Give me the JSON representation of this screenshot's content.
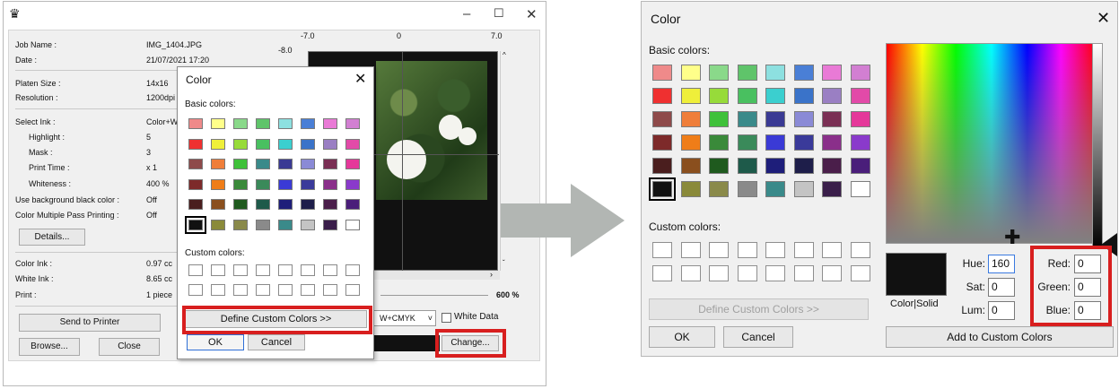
{
  "app": {
    "info": [
      {
        "label": "Job Name :",
        "value": "IMG_1404.JPG"
      },
      {
        "label": "Date :",
        "value": "21/07/2021 17:20"
      },
      {
        "label": "Platen Size :",
        "value": "14x16"
      },
      {
        "label": "Resolution :",
        "value": "1200dpi x"
      },
      {
        "label": "Select Ink :",
        "value": "Color+W"
      },
      {
        "label": "Highlight :",
        "value": "5"
      },
      {
        "label": "Mask :",
        "value": "3"
      },
      {
        "label": "Print Time :",
        "value": "x 1"
      },
      {
        "label": "Whiteness :",
        "value": "400 %"
      },
      {
        "label": "Use background black color :",
        "value": "Off"
      },
      {
        "label": "Color Multiple Pass Printing :",
        "value": "Off"
      },
      {
        "label": "Color Ink :",
        "value": "0.97 cc"
      },
      {
        "label": "White Ink :",
        "value": "8.65 cc"
      },
      {
        "label": "Print :",
        "value": "1 piece"
      }
    ],
    "details_label": "Details...",
    "send_label": "Send to Printer",
    "browse_label": "Browse...",
    "close_label": "Close",
    "ruler": {
      "top_left": "-7.0",
      "top_mid": "0",
      "top_right": "7.0",
      "side_top": "-8.0"
    },
    "zoom": "600 %",
    "ink_mode": "W+CMYK",
    "white_data_label": "White Data",
    "change_label": "Change..."
  },
  "small_dialog": {
    "title": "Color",
    "basic_label": "Basic colors:",
    "custom_label": "Custom colors:",
    "define_label": "Define Custom Colors >>",
    "ok_label": "OK",
    "cancel_label": "Cancel"
  },
  "big_dialog": {
    "title": "Color",
    "basic_label": "Basic colors:",
    "custom_label": "Custom colors:",
    "define_label": "Define Custom Colors >>",
    "ok_label": "OK",
    "cancel_label": "Cancel",
    "color_solid_label": "Color|Solid",
    "hue_label": "Hue:",
    "hue_value": "160",
    "sat_label": "Sat:",
    "sat_value": "0",
    "lum_label": "Lum:",
    "lum_value": "0",
    "red_label": "Red:",
    "red_value": "0",
    "green_label": "Green:",
    "green_value": "0",
    "blue_label": "Blue:",
    "blue_value": "0",
    "add_label": "Add to Custom Colors"
  },
  "palette": [
    [
      "#ef8a8a",
      "#ffff8a",
      "#8ad98a",
      "#5fc46a",
      "#8de0e0",
      "#4a7fd6",
      "#e97ad6",
      "#d27fd2"
    ],
    [
      "#ef3030",
      "#efef3a",
      "#97db3a",
      "#49c060",
      "#3bcfcf",
      "#3a73c9",
      "#9a7fc3",
      "#e24aa8"
    ],
    [
      "#8e4a4a",
      "#ef7e3a",
      "#3fc13a",
      "#3a8a8a",
      "#3a3a94",
      "#8a8ad6",
      "#7a2f54",
      "#e5389a"
    ],
    [
      "#7d2a2a",
      "#ef7d18",
      "#3a8a3a",
      "#3a8a5a",
      "#3a3ad6",
      "#3a3a9a",
      "#8a2f8a",
      "#8a3acb"
    ],
    [
      "#4a1e1e",
      "#8a4f1e",
      "#1f5a1e",
      "#1e5a4a",
      "#1e1e7a",
      "#1e1e4a",
      "#4a1e4a",
      "#4a1e7a"
    ],
    [
      "#111111",
      "#8a8a3a",
      "#8a8a4a",
      "#8a8a8a",
      "#3a8a8a",
      "#c4c4c4",
      "#3a1e4a",
      "#ffffff"
    ]
  ]
}
